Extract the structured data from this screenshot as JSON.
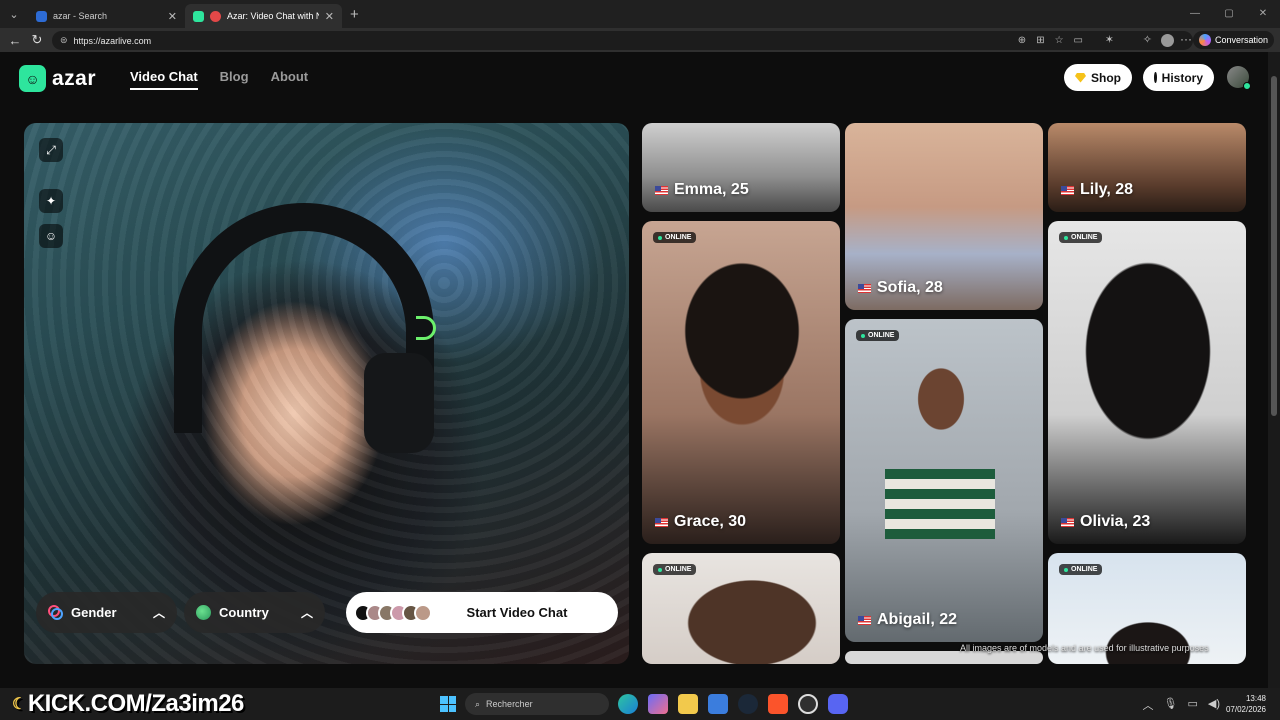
{
  "browser": {
    "tabs": [
      {
        "title": "azar - Search",
        "active": false
      },
      {
        "title": "Azar: Video Chat with New Pe",
        "active": true
      }
    ],
    "url": "https://azarlive.com",
    "conversation_label": "Conversation"
  },
  "app": {
    "logo_text": "azar",
    "nav": [
      "Video Chat",
      "Blog",
      "About"
    ],
    "shop_label": "Shop",
    "history_label": "History"
  },
  "camera": {
    "gender_label": "Gender",
    "country_label": "Country",
    "start_label": "Start Video Chat"
  },
  "profiles": [
    {
      "name": "Emma, 25",
      "online": false
    },
    {
      "name": "Sofia, 28",
      "online": false
    },
    {
      "name": "Lily, 28",
      "online": false
    },
    {
      "name": "Grace, 30",
      "online": true
    },
    {
      "name": "Abigail, 22",
      "online": true
    },
    {
      "name": "Olivia, 23",
      "online": true
    },
    {
      "name": "",
      "online": true
    },
    {
      "name": "",
      "online": true
    }
  ],
  "online_label": "ONLINE",
  "disclaimer": "All images are of models and are used for illustrative purposes",
  "taskbar": {
    "overlay_text": "KICK.COM/Za3im26",
    "search_placeholder": "Rechercher",
    "time": "13:48",
    "date": "07/02/2026"
  },
  "colors": {
    "accent": "#2ee59d",
    "gem": "#f5c21a",
    "kick_green": "#53fc18"
  }
}
